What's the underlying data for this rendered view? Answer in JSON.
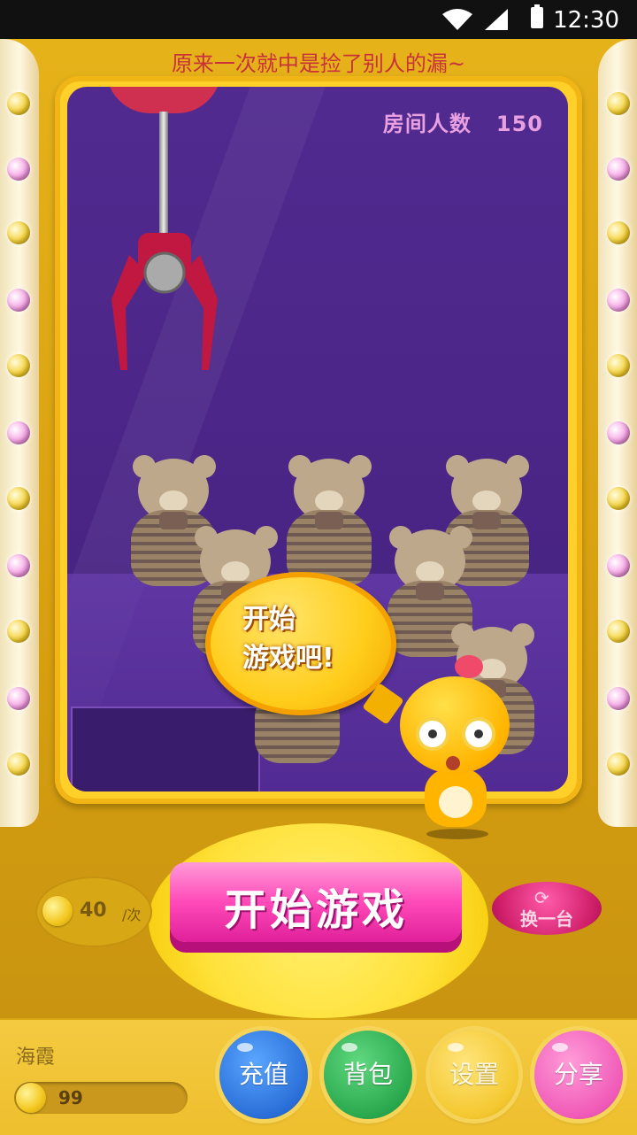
{
  "status_bar": {
    "time": "12:30"
  },
  "marquee_text": "原来一次就中是捡了别人的漏~",
  "room": {
    "label": "房间人数",
    "count": "150"
  },
  "speech_bubble": {
    "line1": "开始",
    "line2": "游戏吧!"
  },
  "start_button": {
    "label": "开始游戏"
  },
  "cost": {
    "amount": "40",
    "unit": "/次"
  },
  "switch_button": {
    "label": "换一台"
  },
  "player": {
    "name": "海霞",
    "coins": "99"
  },
  "nav_buttons": [
    {
      "label": "充值",
      "color": "#2a6fd8"
    },
    {
      "label": "背包",
      "color": "#2aa84e"
    },
    {
      "label": "设置",
      "color": "#f4c830"
    },
    {
      "label": "分享",
      "color": "#f05ab8"
    }
  ],
  "colors": {
    "frame": "#e6b21a",
    "glass": "#512a8f",
    "accent_pink": "#ff4ab8"
  }
}
